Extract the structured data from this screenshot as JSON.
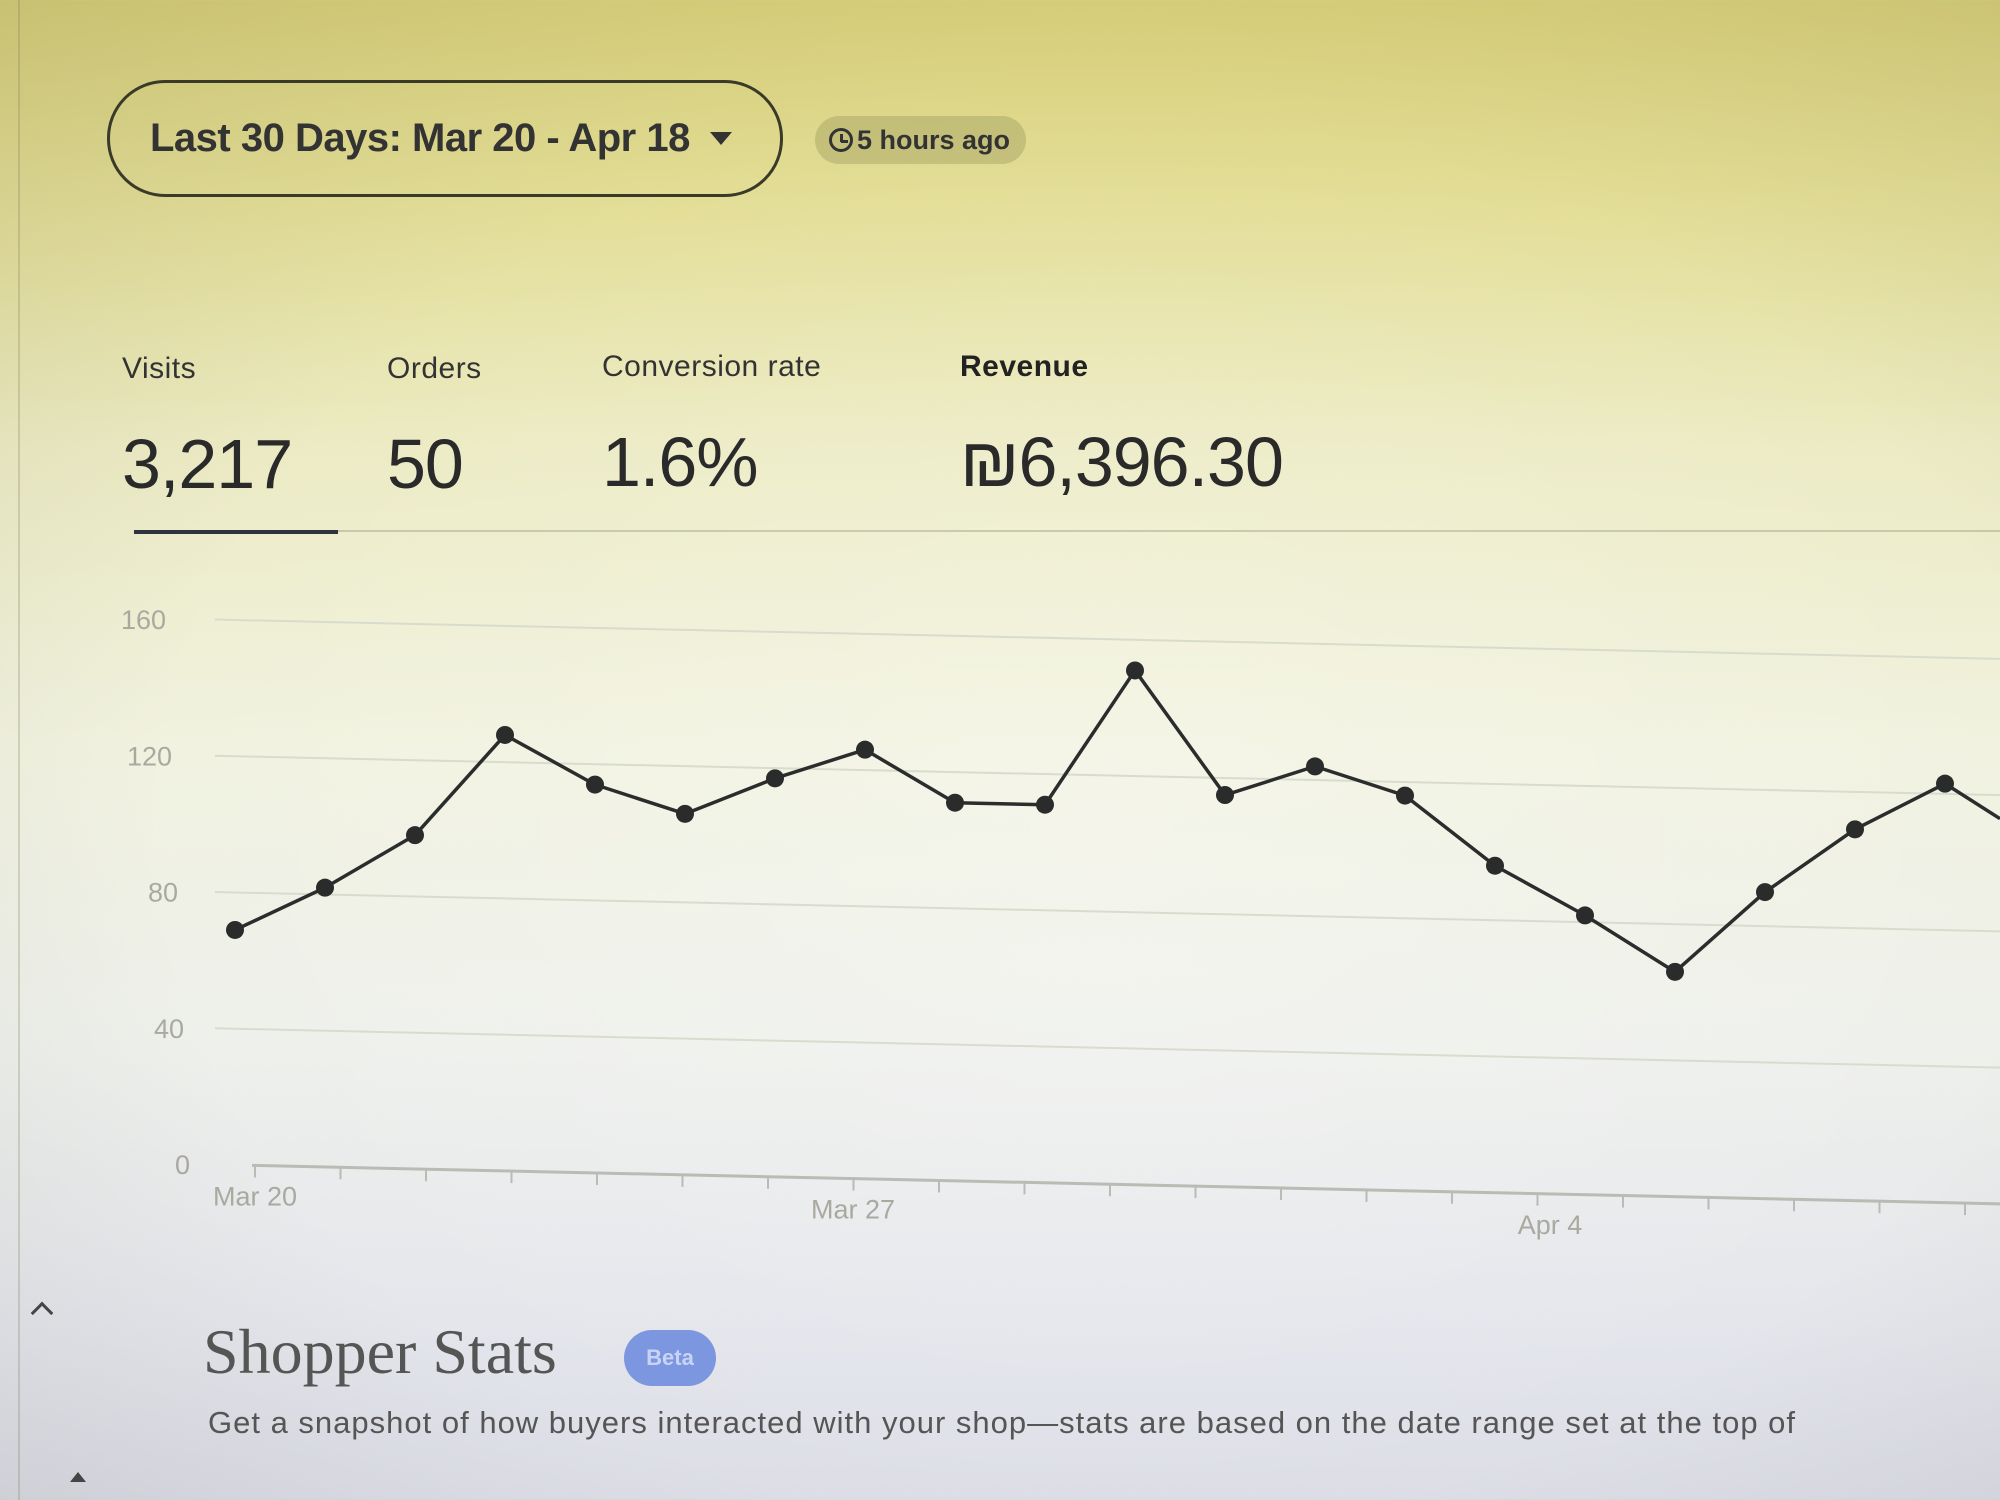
{
  "header": {
    "date_range_label": "Last 30 Days: Mar 20 - Apr 18",
    "updated_label": "5 hours ago"
  },
  "metrics": [
    {
      "label": "Visits",
      "value": "3,217"
    },
    {
      "label": "Orders",
      "value": "50"
    },
    {
      "label": "Conversion rate",
      "value": "1.6%"
    },
    {
      "label": "Revenue",
      "value": "₪6,396.30"
    }
  ],
  "selected_metric": "Visits",
  "colors": {
    "line": "#2b2d2d",
    "point": "#2a2b2b",
    "grid": "#d8dccc",
    "tab_underline": "#2f3340",
    "beta_badge": "#7c97df"
  },
  "chart_data": {
    "type": "line",
    "x": [
      "Mar 20",
      "Mar 21",
      "Mar 22",
      "Mar 23",
      "Mar 24",
      "Mar 25",
      "Mar 26",
      "Mar 27",
      "Mar 28",
      "Mar 29",
      "Mar 30",
      "Mar 31",
      "Apr 1",
      "Apr 2",
      "Apr 3",
      "Apr 4",
      "Apr 5",
      "Apr 6",
      "Apr 7",
      "Apr 8"
    ],
    "series": [
      {
        "values": [
          69,
          82,
          98,
          128,
          114,
          106,
          117,
          126,
          111,
          111,
          151,
          115,
          124,
          116,
          96,
          82,
          66,
          90,
          109,
          123
        ]
      }
    ],
    "ylim": [
      0,
      160
    ],
    "yticks": [
      0,
      40,
      80,
      120,
      160
    ],
    "xtick_labels": [
      "Mar 20",
      "Mar 27",
      "Apr 4"
    ],
    "grid": true,
    "xlabel": "",
    "ylabel": ""
  },
  "shopper_stats": {
    "title": "Shopper Stats",
    "badge": "Beta",
    "description": "Get a snapshot of how buyers interacted with your shop—stats are based on the date range set at the top of"
  }
}
